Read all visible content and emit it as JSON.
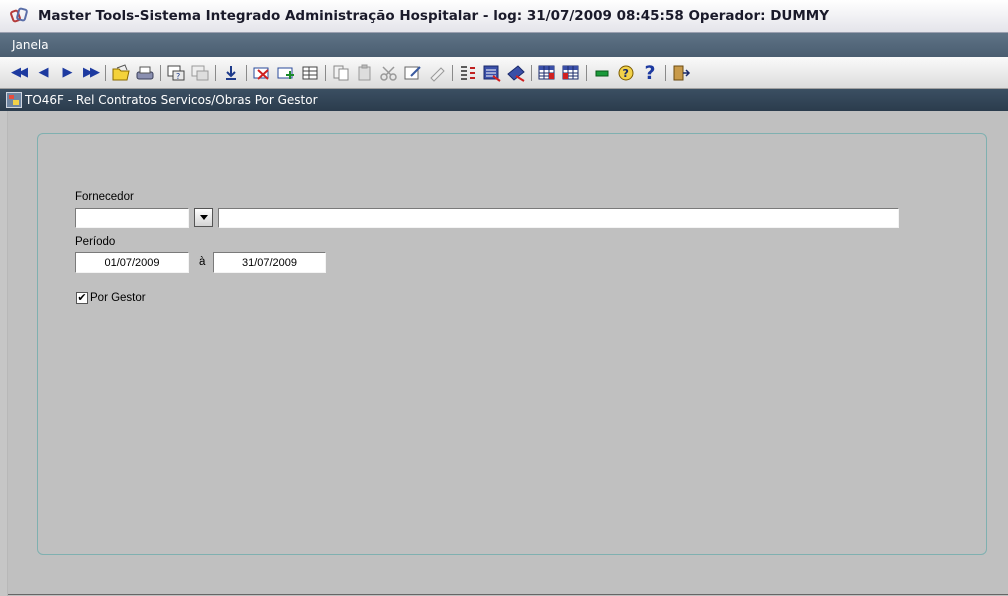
{
  "window": {
    "title": "Master Tools-Sistema Integrado Administração Hospitalar -  log: 31/07/2009 08:45:58 Operador: DUMMY"
  },
  "menu": {
    "items": [
      {
        "label": "Janela"
      }
    ]
  },
  "toolbar": {
    "icons": [
      "first-record-icon",
      "previous-record-icon",
      "next-record-icon",
      "last-record-icon",
      "open-folder-icon",
      "print-icon",
      "query-icon",
      "execute-query-icon",
      "download-icon",
      "delete-record-icon",
      "insert-record-icon",
      "duplicate-record-icon",
      "copy-icon",
      "paste-icon",
      "cut-icon",
      "edit-icon",
      "clear-icon",
      "list-values-icon",
      "display-list-icon",
      "clear-field-icon",
      "grid-icon",
      "grid-alt-icon",
      "minimize-icon",
      "help-icon",
      "question-icon",
      "exit-icon"
    ]
  },
  "form": {
    "title": "TO46F - Rel Contratos Servicos/Obras Por Gestor",
    "fornecedor": {
      "label": "Fornecedor",
      "code_value": "",
      "name_value": ""
    },
    "periodo": {
      "label": "Período",
      "start": "01/07/2009",
      "separator": "à",
      "end": "31/07/2009"
    },
    "por_gestor": {
      "label": "Por Gestor",
      "checked": true,
      "check_mark": "✔"
    }
  },
  "colors": {
    "menubar": "#4f6376",
    "formbar": "#33475a",
    "panel_border": "#7fb0b0",
    "background": "#c0c0c0"
  }
}
